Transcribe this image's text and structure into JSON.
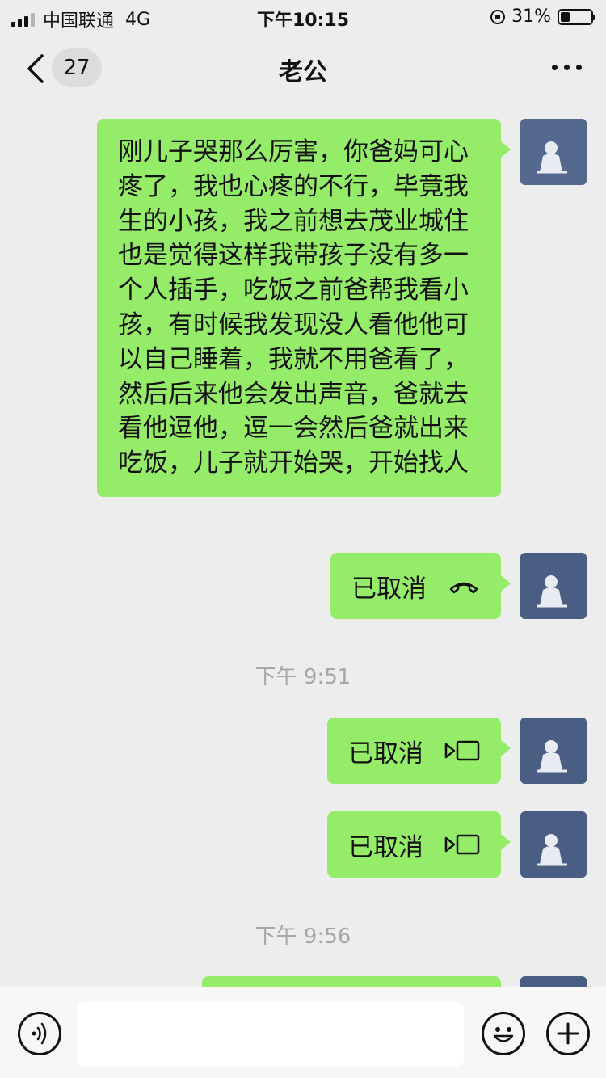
{
  "status_bar": {
    "carrier": "中国联通",
    "network": "4G",
    "time": "下午10:15",
    "battery_percent": "31%",
    "battery_level": 0.31
  },
  "header": {
    "back_badge": "27",
    "title": "老公"
  },
  "messages": [
    {
      "type": "text",
      "side": "right",
      "text": "刚儿子哭那么厉害，你爸妈可心疼了，我也心疼的不行，毕竟我生的小孩，我之前想去茂业城住也是觉得这样我带孩子没有多一个人插手，吃饭之前爸帮我看小孩，有时候我发现没人看他他可以自己睡着，我就不用爸看了，然后后来他会发出声音，爸就去看他逗他，逗一会然后爸就出来吃饭，儿子就开始哭，开始找人"
    },
    {
      "type": "call",
      "side": "right",
      "label": "已取消",
      "icon": "phone-hangup-icon"
    },
    {
      "type": "time",
      "text": "下午 9:51"
    },
    {
      "type": "call",
      "side": "right",
      "label": "已取消",
      "icon": "video-camera-icon"
    },
    {
      "type": "call",
      "side": "right",
      "label": "已取消",
      "icon": "video-camera-icon"
    },
    {
      "type": "time",
      "text": "下午 9:56"
    },
    {
      "type": "text",
      "side": "right",
      "text": ""
    }
  ],
  "input_bar": {
    "voice_icon": "voice-icon",
    "input_value": "",
    "emoji_icon": "emoji-icon",
    "plus_icon": "plus-icon"
  },
  "colors": {
    "background": "#ededed",
    "bubble": "#95ec69",
    "avatar": "#4a5e83",
    "timestamp": "#a7a7a7"
  }
}
